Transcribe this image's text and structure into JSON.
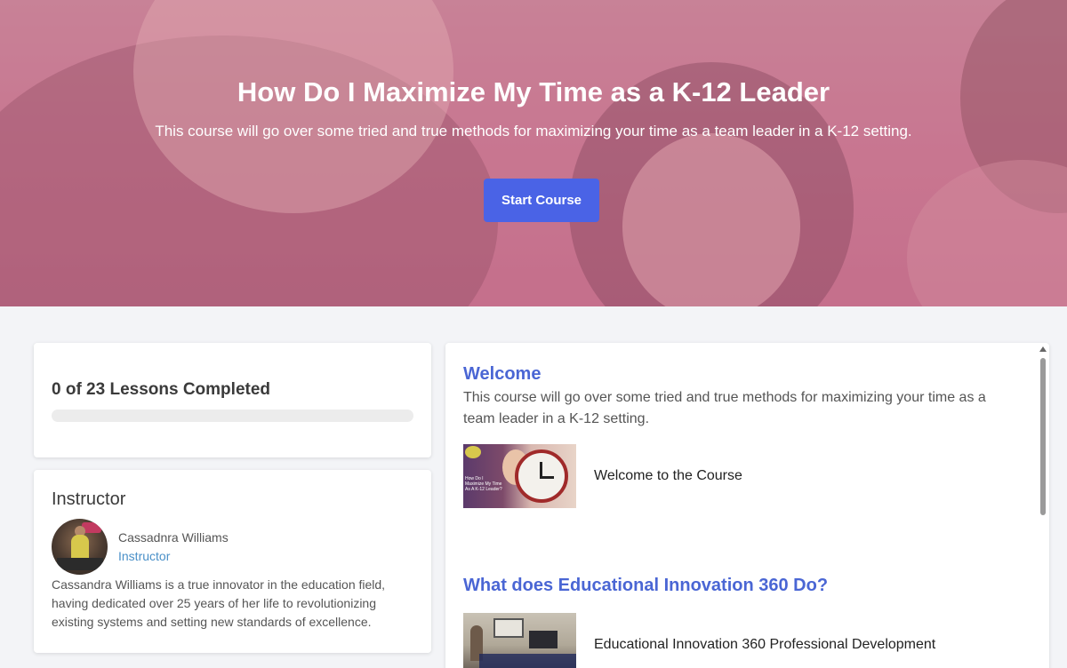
{
  "hero": {
    "title": "How Do I Maximize My Time as a K-12 Leader",
    "subtitle": "This course will go over some tried and true methods for maximizing your time as a team leader in a K-12 setting.",
    "start_label": "Start Course"
  },
  "progress": {
    "label": "0 of 23 Lessons Completed",
    "completed": 0,
    "total": 23,
    "fraction": 0
  },
  "instructor": {
    "heading": "Instructor",
    "name": "Cassadnra Williams",
    "role": "Instructor",
    "bio": "Cassandra Williams is a true innovator in the education field, having dedicated over 25 years of her life to revolutionizing existing systems and setting new standards of excellence."
  },
  "sections": [
    {
      "title": "Welcome",
      "description": "This course will go over some tried and true methods for maximizing your time as a team leader in a K-12 setting.",
      "lessons": [
        {
          "title": "Welcome to the Course",
          "thumb_text": "How Do I Maximize My Time As A K-12 Leader?"
        }
      ]
    },
    {
      "title": "What does Educational Innovation 360 Do?",
      "lessons": [
        {
          "title": "Educational Innovation 360 Professional Development"
        }
      ]
    }
  ],
  "colors": {
    "accent": "#4a63e6",
    "section_title": "#4a66d4",
    "instructor_role": "#4a90c8",
    "hero_tint": "#c97a93"
  }
}
